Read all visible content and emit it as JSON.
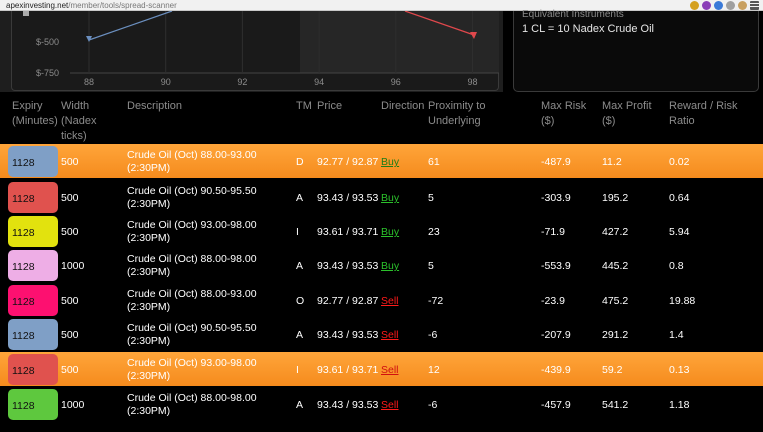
{
  "browser": {
    "url_host": "apexinvesting.net",
    "url_path": "/member/tools/spread-scanner"
  },
  "chart": {
    "y_ticks": [
      "$-500",
      "$-750"
    ],
    "x_ticks": [
      "88",
      "90",
      "92",
      "94",
      "96",
      "98"
    ],
    "colors": {
      "series_blue": "#6b8fbf",
      "series_red": "#e0484c"
    }
  },
  "info": {
    "title": "Equivalent Instruments",
    "line": "1 CL = 10 Nadex Crude Oil"
  },
  "table": {
    "headers": {
      "expiry": [
        "Expiry",
        "(Minutes)"
      ],
      "width": [
        "Width",
        "(Nadex",
        "ticks)"
      ],
      "description": "Description",
      "tm": "TM",
      "price": "Price",
      "direction": "Direction",
      "proximity": [
        "Proximity to",
        "Underlying"
      ],
      "max_risk": [
        "Max Risk",
        "($)"
      ],
      "max_profit": [
        "Max Profit",
        "($)"
      ],
      "ratio": "Reward / Risk Ratio"
    },
    "rows": [
      {
        "expiry": "1128",
        "color": "#7f9fc6",
        "highlight": true,
        "width": "500",
        "desc1": "Crude Oil (Oct) 88.00-93.00",
        "desc2": "(2:30PM)",
        "tm": "D",
        "price": "92.77 / 92.87",
        "direction": "Buy",
        "proximity": "61",
        "max_risk": "-487.9",
        "max_profit": "11.2",
        "ratio": "0.02"
      },
      {
        "expiry": "1128",
        "color": "#e0524e",
        "highlight": false,
        "width": "500",
        "desc1": "Crude Oil (Oct) 90.50-95.50",
        "desc2": "(2:30PM)",
        "tm": "A",
        "price": "93.43 / 93.53",
        "direction": "Buy",
        "proximity": "5",
        "max_risk": "-303.9",
        "max_profit": "195.2",
        "ratio": "0.64"
      },
      {
        "expiry": "1128",
        "color": "#e2e20e",
        "highlight": false,
        "width": "500",
        "desc1": "Crude Oil (Oct) 93.00-98.00",
        "desc2": "(2:30PM)",
        "tm": "I",
        "price": "93.61 / 93.71",
        "direction": "Buy",
        "proximity": "23",
        "max_risk": "-71.9",
        "max_profit": "427.2",
        "ratio": "5.94"
      },
      {
        "expiry": "1128",
        "color": "#eeaee6",
        "highlight": false,
        "width": "1000",
        "desc1": "Crude Oil (Oct) 88.00-98.00",
        "desc2": "(2:30PM)",
        "tm": "A",
        "price": "93.43 / 93.53",
        "direction": "Buy",
        "proximity": "5",
        "max_risk": "-553.9",
        "max_profit": "445.2",
        "ratio": "0.8"
      },
      {
        "expiry": "1128",
        "color": "#fd1070",
        "highlight": false,
        "width": "500",
        "desc1": "Crude Oil (Oct) 88.00-93.00",
        "desc2": "(2:30PM)",
        "tm": "O",
        "price": "92.77 / 92.87",
        "direction": "Sell",
        "proximity": "-72",
        "max_risk": "-23.9",
        "max_profit": "475.2",
        "ratio": "19.88"
      },
      {
        "expiry": "1128",
        "color": "#7f9fc6",
        "highlight": false,
        "width": "500",
        "desc1": "Crude Oil (Oct) 90.50-95.50",
        "desc2": "(2:30PM)",
        "tm": "A",
        "price": "93.43 / 93.53",
        "direction": "Sell",
        "proximity": "-6",
        "max_risk": "-207.9",
        "max_profit": "291.2",
        "ratio": "1.4"
      },
      {
        "expiry": "1128",
        "color": "#e0524e",
        "highlight": true,
        "width": "500",
        "desc1": "Crude Oil (Oct) 93.00-98.00",
        "desc2": "(2:30PM)",
        "tm": "I",
        "price": "93.61 / 93.71",
        "direction": "Sell",
        "proximity": "12",
        "max_risk": "-439.9",
        "max_profit": "59.2",
        "ratio": "0.13"
      },
      {
        "expiry": "1128",
        "color": "#5ec83e",
        "highlight": false,
        "width": "1000",
        "desc1": "Crude Oil (Oct) 88.00-98.00",
        "desc2": "(2:30PM)",
        "tm": "A",
        "price": "93.43 / 93.53",
        "direction": "Sell",
        "proximity": "-6",
        "max_risk": "-457.9",
        "max_profit": "541.2",
        "ratio": "1.18"
      }
    ]
  }
}
